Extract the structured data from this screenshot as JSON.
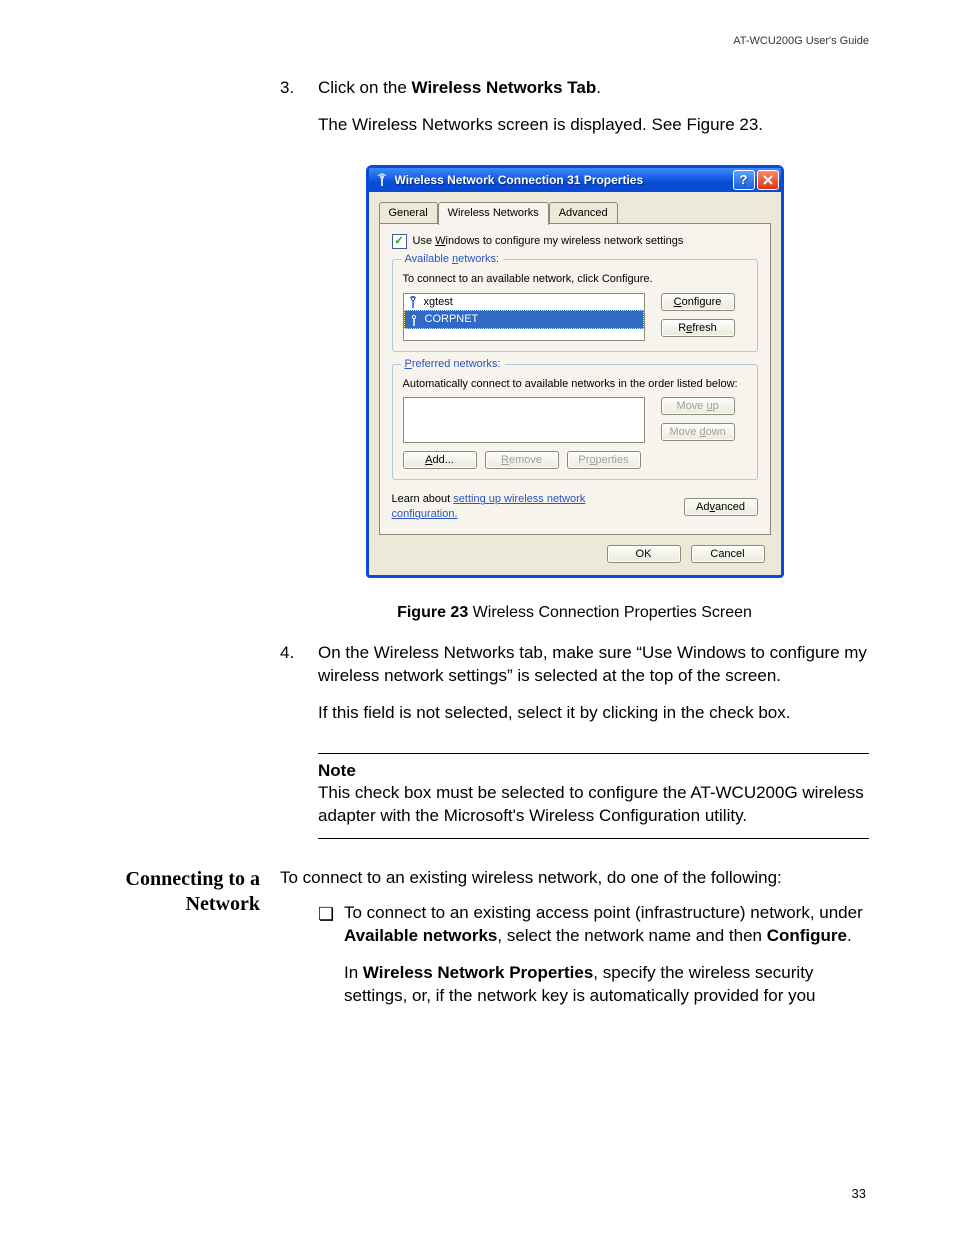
{
  "header": {
    "right": "AT-WCU200G User's Guide"
  },
  "steps": {
    "s3": {
      "num": "3.",
      "line1_a": "Click on the ",
      "line1_b": "Wireless Networks Tab",
      "line1_c": ".",
      "line2": "The Wireless Networks screen is displayed. See Figure 23."
    },
    "s4": {
      "num": "4.",
      "p1": "On the Wireless Networks tab, make sure “Use Windows to configure my wireless network settings” is selected at the top of the screen.",
      "p2": "If this field is not selected, select it by clicking in the check box."
    }
  },
  "caption": {
    "bold": "Figure 23",
    "rest": "  Wireless Connection Properties Screen"
  },
  "note": {
    "title": "Note",
    "text": "This check box must be selected to configure the AT-WCU200G wireless adapter with the Microsoft's Wireless Configuration utility."
  },
  "sidehead": "Connecting to a Network",
  "connect": {
    "intro": "To connect to an existing wireless network, do one of the following:",
    "bullet1_a": "To connect to an existing access point (infrastructure) network, under ",
    "bullet1_b": "Available networks",
    "bullet1_c": ", select the network name and then ",
    "bullet1_d": "Configure",
    "bullet1_e": ".",
    "bullet2_a": "In ",
    "bullet2_b": "Wireless Network Properties",
    "bullet2_c": ", specify the wireless security settings, or, if the network key is automatically provided for you"
  },
  "pagenum": "33",
  "dialog": {
    "title": "Wireless Network Connection 31 Properties",
    "tabs": {
      "general": "General",
      "wireless": "Wireless Networks",
      "advanced": "Advanced"
    },
    "check_a": "Use ",
    "check_key": "W",
    "check_b": "indows to configure my wireless network settings",
    "check_checked": true,
    "available": {
      "title_a": "Available ",
      "title_key": "n",
      "title_b": "etworks:",
      "instruction": "To connect to an available network, click Configure.",
      "items": [
        {
          "name": "xgtest",
          "selected": false
        },
        {
          "name": "CORPNET",
          "selected": true
        }
      ],
      "configure_a": "",
      "configure_key": "C",
      "configure_b": "onfigure",
      "refresh_a": "R",
      "refresh_key": "e",
      "refresh_b": "fresh"
    },
    "preferred": {
      "title_a": "",
      "title_key": "P",
      "title_b": "referred networks:",
      "instruction": "Automatically connect to available networks in the order listed below:",
      "moveup_a": "Move ",
      "moveup_key": "u",
      "moveup_b": "p",
      "movedown_a": "Move ",
      "movedown_key": "d",
      "movedown_b": "own",
      "add_key": "A",
      "add_b": "dd...",
      "remove_key": "R",
      "remove_b": "emove",
      "props_a": "Pr",
      "props_key": "o",
      "props_b": "perties"
    },
    "learn_a": "Learn about ",
    "learn_link": "setting up wireless network configuration.",
    "advbtn_a": "Ad",
    "advbtn_key": "v",
    "advbtn_b": "anced",
    "ok": "OK",
    "cancel": "Cancel"
  }
}
